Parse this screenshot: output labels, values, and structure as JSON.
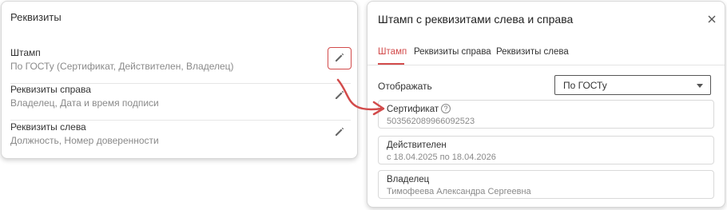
{
  "left_panel": {
    "title": "Реквизиты",
    "rows": [
      {
        "label": "Штамп",
        "value": "По ГОСТу (Сертификат, Действителен, Владелец)"
      },
      {
        "label": "Реквизиты справа",
        "value": "Владелец, Дата и время подписи"
      },
      {
        "label": "Реквизиты слева",
        "value": "Должность, Номер доверенности"
      }
    ]
  },
  "dialog": {
    "title": "Штамп с реквизитами слева и справа",
    "tabs": [
      {
        "label": "Штамп",
        "active": true
      },
      {
        "label": "Реквизиты справа",
        "active": false
      },
      {
        "label": "Реквизиты слева",
        "active": false
      }
    ],
    "display_label": "Отображать",
    "display_select": {
      "value": "По ГОСТу"
    },
    "fields": [
      {
        "label": "Сертификат",
        "value": "503562089966092523",
        "has_help": true
      },
      {
        "label": "Действителен",
        "value": "с 18.04.2025 по 18.04.2026",
        "has_help": false
      },
      {
        "label": "Владелец",
        "value": "Тимофеева Александра Сергеевна",
        "has_help": false
      }
    ]
  },
  "colors": {
    "accent": "#d24b4b",
    "muted_text": "#8a8a8a",
    "border": "#d9d9d9"
  },
  "icons": [
    "pencil-icon",
    "close-icon",
    "help-circle-icon",
    "chevron-down-icon",
    "curved-arrow-icon"
  ]
}
